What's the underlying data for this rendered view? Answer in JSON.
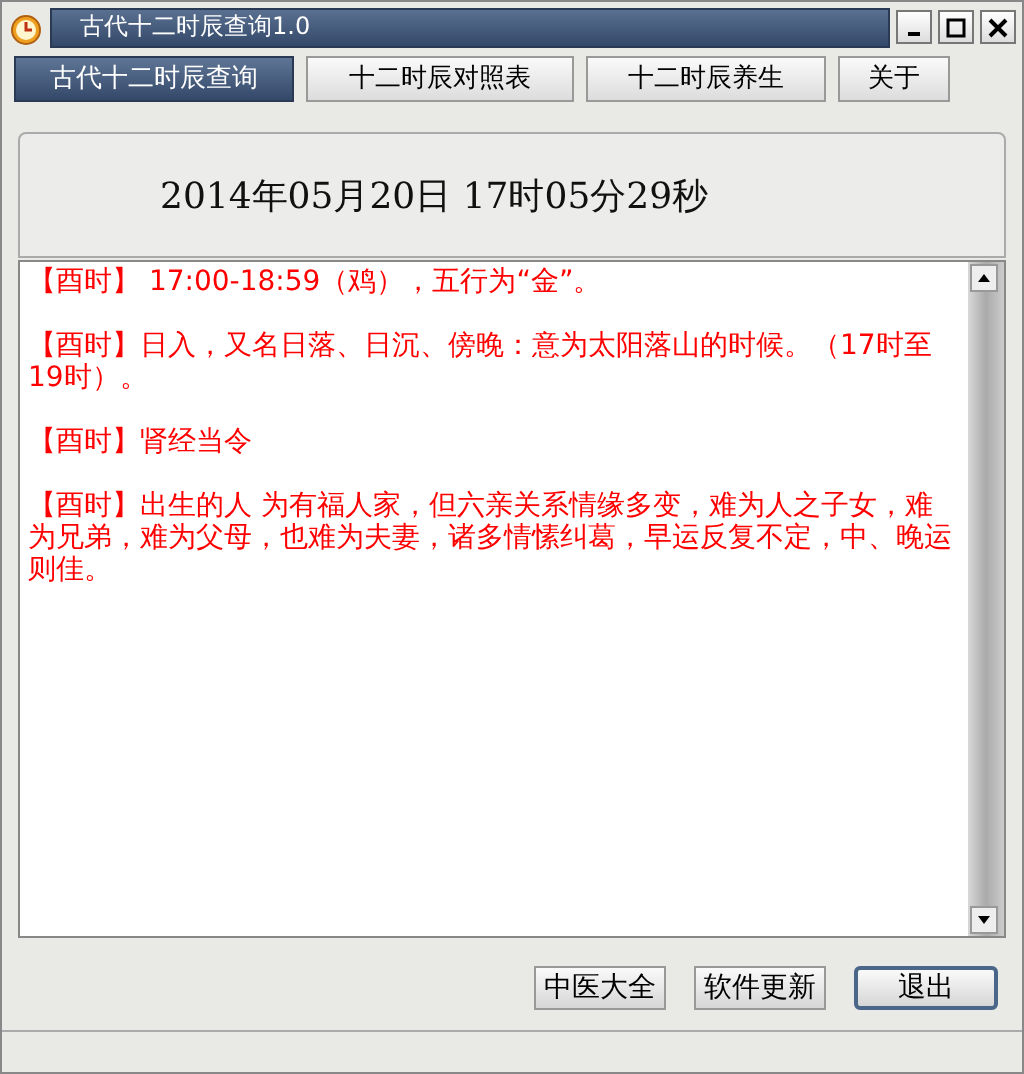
{
  "window": {
    "title": "古代十二时辰查询1.0"
  },
  "tabs": [
    {
      "label": "古代十二时辰查询",
      "selected": true
    },
    {
      "label": "十二时辰对照表",
      "selected": false
    },
    {
      "label": "十二时辰养生",
      "selected": false
    },
    {
      "label": "关于",
      "selected": false
    }
  ],
  "datetime": "2014年05月20日  17时05分29秒",
  "paragraphs": [
    "【酉时】 17:00-18:59（鸡），五行为“金”。",
    "【酉时】日入，又名日落、日沉、傍晚：意为太阳落山的时候。（17时至19时）。",
    "【酉时】肾经当令",
    "【酉时】出生的人 为有福人家，但六亲关系情缘多变，难为人之子女，难为兄弟，难为父母，也难为夫妻，诸多情愫纠葛，早运反复不定，中、晚运则佳。"
  ],
  "buttons": [
    {
      "label": "中医大全",
      "selected": false
    },
    {
      "label": "软件更新",
      "selected": false
    },
    {
      "label": "退出",
      "selected": true
    }
  ]
}
